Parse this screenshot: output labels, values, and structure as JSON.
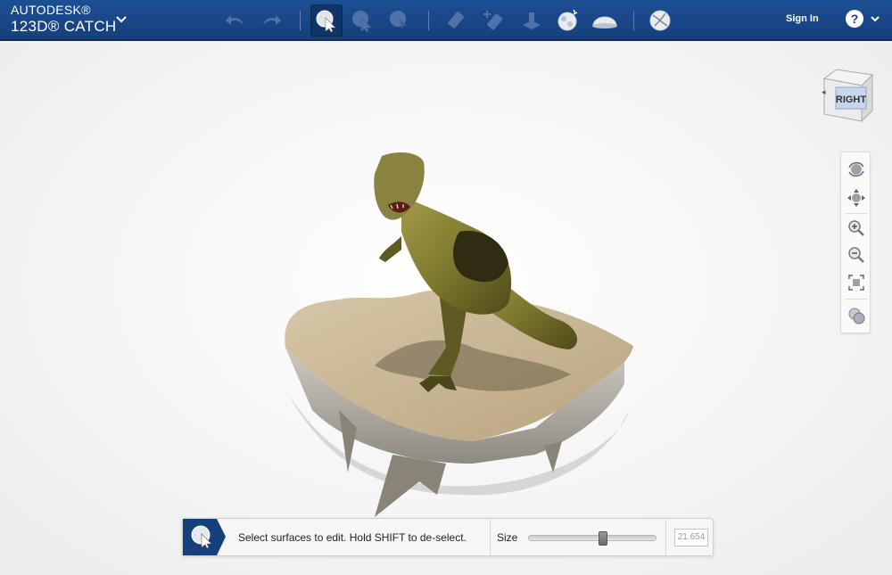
{
  "app": {
    "brand_line1": "AUTODESK®",
    "brand_line2": "123D® CATCH"
  },
  "toolbar": {
    "icons": [
      "undo-icon",
      "redo-icon",
      "select-surface-icon",
      "select-lasso-icon",
      "select-paint-icon",
      "eraser-icon",
      "add-icon",
      "extrude-icon",
      "refine-icon",
      "smooth-icon",
      "sphere-icon"
    ]
  },
  "header": {
    "sign_in": "Sign In",
    "help": "?"
  },
  "viewcube": {
    "face": "RIGHT"
  },
  "status": {
    "message": "Select surfaces to edit. Hold SHIFT to de-select.",
    "size_label": "Size",
    "size_value": "21.654",
    "slider_fraction": 0.58
  },
  "colors": {
    "topbar": "#1d4f94",
    "active_tool": "#0f3468",
    "accent": "#163f7c"
  }
}
